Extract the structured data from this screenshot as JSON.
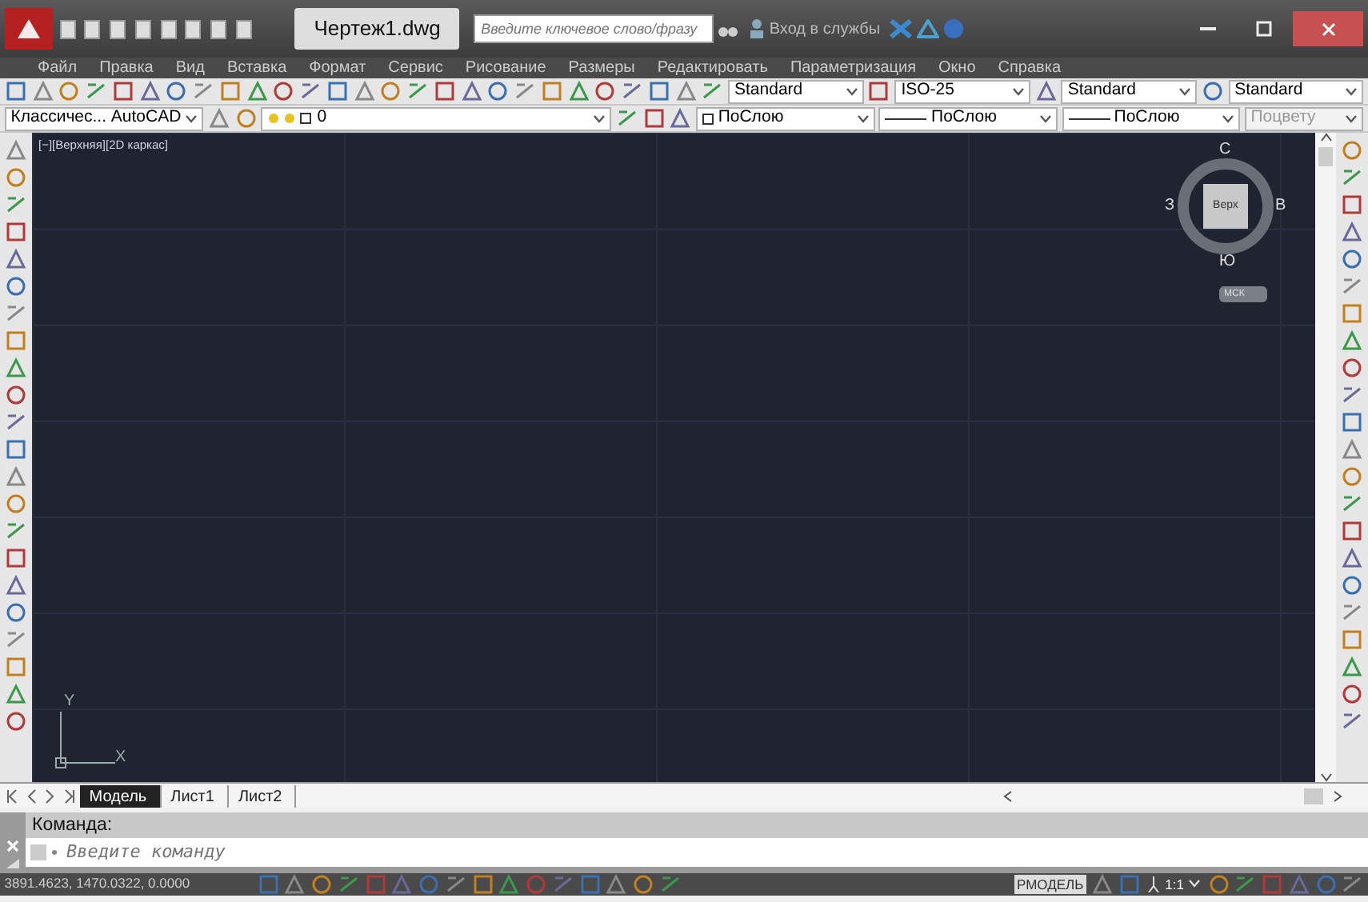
{
  "title_bar": {
    "title": "Чертеж1.dwg",
    "search": {
      "placeholder": "Введите ключевое слово/фразу"
    },
    "sign_in": "Вход в службы"
  },
  "menu": [
    "Файл",
    "Правка",
    "Вид",
    "Вставка",
    "Формат",
    "Сервис",
    "Рисование",
    "Размеры",
    "Редактировать",
    "Параметризация",
    "Окно",
    "Справка"
  ],
  "toolbar_1": {
    "styles": [
      {
        "value": "Standard"
      },
      {
        "value": "ISO-25"
      },
      {
        "value": "Standard"
      },
      {
        "value": "Standard"
      }
    ]
  },
  "toolbar_2": {
    "workspace": "Классичес... AutoCAD",
    "layer": "0",
    "properties": [
      {
        "value": "ПоСлою",
        "kind": "color",
        "disabled": false
      },
      {
        "value": "ПоСлою",
        "kind": "line",
        "disabled": false
      },
      {
        "value": "ПоСлою",
        "kind": "line",
        "disabled": false
      },
      {
        "value": "Поцвету",
        "kind": "plain",
        "disabled": true
      }
    ]
  },
  "viewport": {
    "label": "[−][Верхняя][2D каркас]",
    "viewcube": {
      "north": "С",
      "west": "З",
      "east": "В",
      "south": "Ю",
      "face": "Верх",
      "ucs": "МСК"
    },
    "axes": {
      "y": "Y",
      "x": "X"
    }
  },
  "layout_tabs": [
    {
      "label": "Модель",
      "selected": true
    },
    {
      "label": "Лист1",
      "selected": false
    },
    {
      "label": "Лист2",
      "selected": false
    }
  ],
  "command": {
    "history": "Команда:",
    "placeholder": "Введите команду"
  },
  "status_bar": {
    "coordinates": "3891.4623, 1470.0322, 0.0000",
    "space": "РМОДЕЛЬ",
    "scale": "1:1"
  }
}
